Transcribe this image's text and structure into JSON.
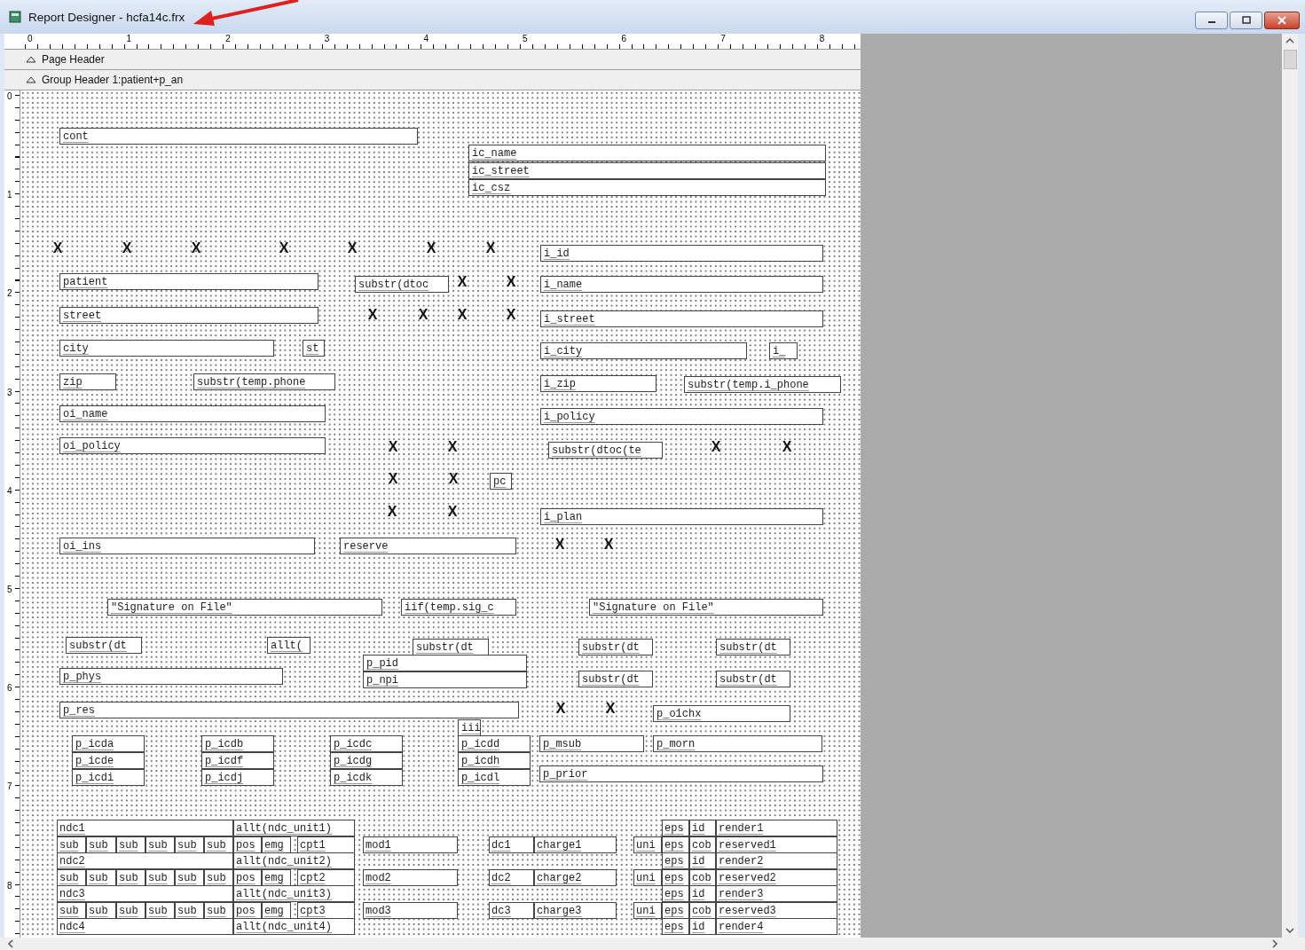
{
  "window": {
    "title": "Report Designer - hcfa14c.frx"
  },
  "ruler": {
    "top_labels": [
      "0",
      "1",
      "2",
      "3",
      "4",
      "5",
      "6",
      "7",
      "8"
    ],
    "left_labels": [
      "0",
      "1",
      "2",
      "3",
      "4",
      "5",
      "6",
      "7",
      "8"
    ]
  },
  "bands": [
    {
      "label": "Page Header"
    },
    {
      "label": "Group Header 1:patient+p_an"
    }
  ],
  "fields": [
    {
      "kind": "field",
      "text": "cont"
    },
    {
      "kind": "field",
      "text": "ic_name"
    },
    {
      "kind": "field",
      "text": "ic_street"
    },
    {
      "kind": "field",
      "text": "ic_csz"
    },
    {
      "kind": "mark",
      "text": "X"
    },
    {
      "kind": "mark",
      "text": "X"
    },
    {
      "kind": "mark",
      "text": "X"
    },
    {
      "kind": "mark",
      "text": "X"
    },
    {
      "kind": "mark",
      "text": "X"
    },
    {
      "kind": "mark",
      "text": "X"
    },
    {
      "kind": "mark",
      "text": "X"
    },
    {
      "kind": "field",
      "text": "i_id"
    },
    {
      "kind": "field",
      "text": "patient"
    },
    {
      "kind": "field",
      "text": "substr(dtoc"
    },
    {
      "kind": "mark",
      "text": "X"
    },
    {
      "kind": "mark",
      "text": "X"
    },
    {
      "kind": "field",
      "text": "i_name"
    },
    {
      "kind": "field",
      "text": "street"
    },
    {
      "kind": "mark",
      "text": "X"
    },
    {
      "kind": "mark",
      "text": "X"
    },
    {
      "kind": "mark",
      "text": "X"
    },
    {
      "kind": "mark",
      "text": "X"
    },
    {
      "kind": "field",
      "text": "i_street"
    },
    {
      "kind": "field",
      "text": "city"
    },
    {
      "kind": "field",
      "text": "st"
    },
    {
      "kind": "field",
      "text": "i_city"
    },
    {
      "kind": "field",
      "text": "i_"
    },
    {
      "kind": "field",
      "text": "zip"
    },
    {
      "kind": "field",
      "text": "substr(temp.phone"
    },
    {
      "kind": "field",
      "text": "i_zip"
    },
    {
      "kind": "field",
      "text": "substr(temp.i_phone"
    },
    {
      "kind": "field",
      "text": "oi_name"
    },
    {
      "kind": "field",
      "text": "i_policy"
    },
    {
      "kind": "field",
      "text": "oi_policy"
    },
    {
      "kind": "mark",
      "text": "X"
    },
    {
      "kind": "mark",
      "text": "X"
    },
    {
      "kind": "field",
      "text": "substr(dtoc(te"
    },
    {
      "kind": "mark",
      "text": "X"
    },
    {
      "kind": "mark",
      "text": "X"
    },
    {
      "kind": "mark",
      "text": "X"
    },
    {
      "kind": "mark",
      "text": "X"
    },
    {
      "kind": "field",
      "text": "pc"
    },
    {
      "kind": "mark",
      "text": "X"
    },
    {
      "kind": "mark",
      "text": "X"
    },
    {
      "kind": "field",
      "text": "i_plan"
    },
    {
      "kind": "field",
      "text": "oi_ins"
    },
    {
      "kind": "field",
      "text": "reserve"
    },
    {
      "kind": "mark",
      "text": "X"
    },
    {
      "kind": "mark",
      "text": "X"
    },
    {
      "kind": "field",
      "text": "\"Signature on File\""
    },
    {
      "kind": "field",
      "text": "iif(temp.sig_c"
    },
    {
      "kind": "field",
      "text": "\"Signature on File\""
    },
    {
      "kind": "field",
      "text": "substr(dt"
    },
    {
      "kind": "field",
      "text": "allt("
    },
    {
      "kind": "field",
      "text": "substr(dt"
    },
    {
      "kind": "field",
      "text": "substr(dt"
    },
    {
      "kind": "field",
      "text": "substr(dt"
    },
    {
      "kind": "field",
      "text": "p_pid"
    },
    {
      "kind": "field",
      "text": "p_phys"
    },
    {
      "kind": "field",
      "text": "p_npi"
    },
    {
      "kind": "field",
      "text": "substr(dt"
    },
    {
      "kind": "field",
      "text": "substr(dt"
    },
    {
      "kind": "field",
      "text": "p_res"
    },
    {
      "kind": "mark",
      "text": "X"
    },
    {
      "kind": "mark",
      "text": "X"
    },
    {
      "kind": "field",
      "text": "p_o1chx"
    },
    {
      "kind": "field",
      "text": "iii"
    },
    {
      "kind": "field",
      "text": "p_icda"
    },
    {
      "kind": "field",
      "text": "p_icdb"
    },
    {
      "kind": "field",
      "text": "p_icdc"
    },
    {
      "kind": "field",
      "text": "p_icdd"
    },
    {
      "kind": "field",
      "text": "p_msub"
    },
    {
      "kind": "field",
      "text": "p_morn"
    },
    {
      "kind": "field",
      "text": "p_icde"
    },
    {
      "kind": "field",
      "text": "p_icdf"
    },
    {
      "kind": "field",
      "text": "p_icdg"
    },
    {
      "kind": "field",
      "text": "p_icdh"
    },
    {
      "kind": "field",
      "text": "p_icdi"
    },
    {
      "kind": "field",
      "text": "p_icdj"
    },
    {
      "kind": "field",
      "text": "p_icdk"
    },
    {
      "kind": "field",
      "text": "p_icdl"
    },
    {
      "kind": "field",
      "text": "p_prior"
    }
  ],
  "detail_lines": [
    {
      "kind": "ndc",
      "cells": [
        "ndc1",
        "allt(ndc_unit1)",
        "eps",
        "id",
        "render1"
      ]
    },
    {
      "kind": "service",
      "cells": [
        "sub",
        "sub",
        "sub",
        "sub",
        "sub",
        "sub",
        "pos",
        "emg",
        "cpt1",
        "mod1",
        "dc1",
        "charge1",
        "uni",
        "eps",
        "cob",
        "reserved1"
      ]
    },
    {
      "kind": "ndc",
      "cells": [
        "ndc2",
        "allt(ndc_unit2)",
        "eps",
        "id",
        "render2"
      ]
    },
    {
      "kind": "service",
      "cells": [
        "sub",
        "sub",
        "sub",
        "sub",
        "sub",
        "sub",
        "pos",
        "emg",
        "cpt2",
        "mod2",
        "dc2",
        "charge2",
        "uni",
        "eps",
        "cob",
        "reserved2"
      ]
    },
    {
      "kind": "ndc",
      "cells": [
        "ndc3",
        "allt(ndc_unit3)",
        "eps",
        "id",
        "render3"
      ]
    },
    {
      "kind": "service",
      "cells": [
        "sub",
        "sub",
        "sub",
        "sub",
        "sub",
        "sub",
        "pos",
        "emg",
        "cpt3",
        "mod3",
        "dc3",
        "charge3",
        "uni",
        "eps",
        "cob",
        "reserved3"
      ]
    },
    {
      "kind": "ndc",
      "cells": [
        "ndc4",
        "allt(ndc_unit4)",
        "eps",
        "id",
        "render4"
      ]
    }
  ]
}
